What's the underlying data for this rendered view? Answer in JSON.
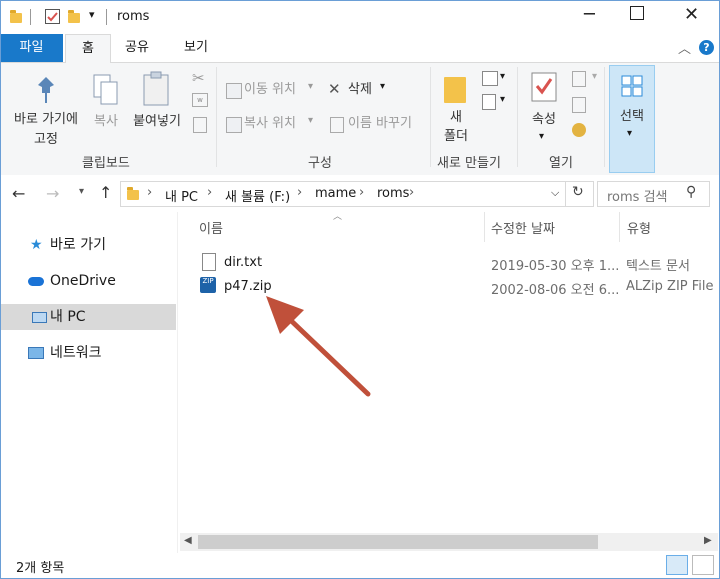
{
  "window": {
    "title": "roms"
  },
  "tabs": {
    "file": "파일",
    "home": "홈",
    "share": "공유",
    "view": "보기"
  },
  "ribbon": {
    "clipboard": {
      "pin": "바로 가기에",
      "pin2": "고정",
      "copy": "복사",
      "paste": "붙여넣기",
      "label": "클립보드"
    },
    "organize": {
      "move_to": "이동 위치",
      "copy_to": "복사 위치",
      "delete": "삭제",
      "rename": "이름 바꾸기",
      "label": "구성"
    },
    "new": {
      "new_folder1": "새",
      "new_folder2": "폴더",
      "label": "새로 만들기"
    },
    "open": {
      "properties": "속성",
      "label": "열기"
    },
    "select": {
      "select": "선택"
    }
  },
  "address": {
    "crumbs": [
      "내 PC",
      "새 볼륨 (F:)",
      "mame",
      "roms"
    ],
    "search_placeholder": "roms 검색"
  },
  "nav": {
    "quick_access": "바로 가기",
    "onedrive": "OneDrive",
    "this_pc": "내 PC",
    "network": "네트워크"
  },
  "columns": {
    "name": "이름",
    "modified": "수정한 날짜",
    "type": "유형"
  },
  "files": [
    {
      "name": "dir.txt",
      "modified": "2019-05-30 오후 1...",
      "type": "텍스트 문서",
      "icon": "text-file-icon"
    },
    {
      "name": "p47.zip",
      "modified": "2002-08-06 오전 6...",
      "type": "ALZip ZIP File",
      "icon": "zip-file-icon"
    }
  ],
  "status": {
    "count": "2개 항목"
  },
  "colors": {
    "accent": "#1979ca",
    "arrow": "#c0503a",
    "folder": "#f3c24a"
  }
}
